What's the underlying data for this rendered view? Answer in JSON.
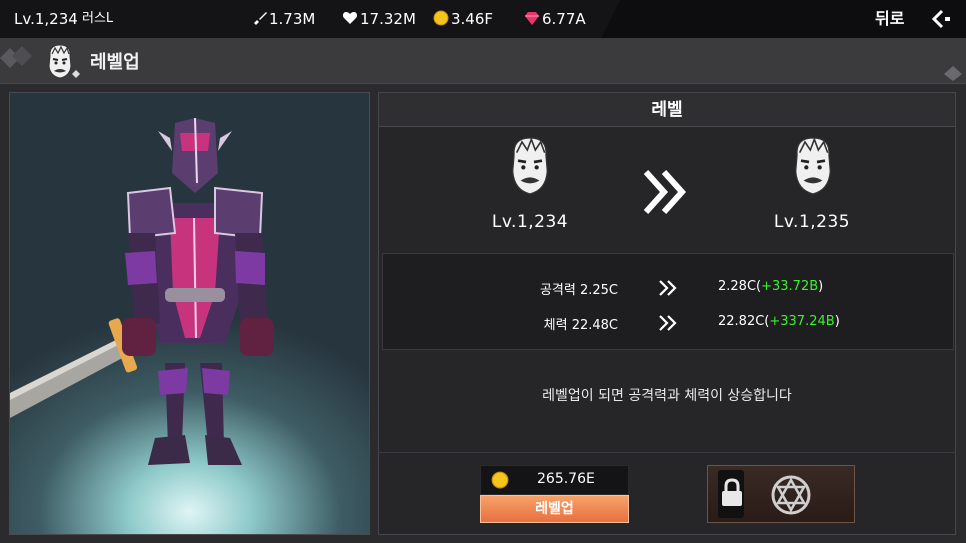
{
  "topbar": {
    "player_level": "Lv.1,234",
    "player_name": "러스L",
    "attack": "1.73M",
    "health": "17.32M",
    "gold": "3.46F",
    "gems": "6.77A",
    "back_label": "뒤로",
    "icons": [
      "sword-icon",
      "heart-icon",
      "gold-coin-icon",
      "gem-icon",
      "back-arrow-icon"
    ]
  },
  "header": {
    "title": "레벨업"
  },
  "panel": {
    "title": "레벨",
    "current_level": "Lv.1,234",
    "next_level": "Lv.1,235"
  },
  "stats": [
    {
      "label": "공격력 2.25C",
      "new_value": "2.28C",
      "bonus": "+33.72B"
    },
    {
      "label": "체력 22.48C",
      "new_value": "22.82C",
      "bonus": "+337.24B"
    }
  ],
  "info_text": "레벨업이 되면 공격력과 체력이 상승합니다",
  "cost": {
    "amount": "265.76E",
    "currency_icon": "gold-coin-icon"
  },
  "levelup_button_label": "레벨업",
  "colors": {
    "bonus_green": "#3bf02e",
    "button_orange": "#e8703f",
    "gem_pink": "#e8356b",
    "gold": "#f6c51b"
  }
}
